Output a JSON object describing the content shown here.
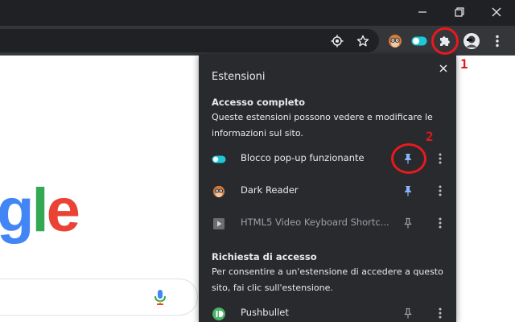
{
  "window_controls": {
    "minimize_icon": "minimize-icon",
    "maximize_icon": "restore-icon",
    "close_icon": "close-icon"
  },
  "toolbar": {
    "icons": [
      "location-target-icon",
      "bookmark-star-icon",
      "dark-reader-extension-icon",
      "toggle-extension-icon",
      "puzzle-extensions-icon",
      "profile-avatar",
      "menu-kebab-icon"
    ]
  },
  "page": {
    "logo_text_g": "g",
    "logo_text_l": "l",
    "logo_text_e": "e"
  },
  "panel": {
    "title": "Estensioni",
    "full_access": {
      "title": "Accesso completo",
      "description": "Queste estensioni possono vedere e modificare le informazioni sul sito.",
      "items": [
        {
          "name": "Blocco pop-up funzionante",
          "icon": "toggle-icon",
          "pinned": true
        },
        {
          "name": "Dark Reader",
          "icon": "dark-reader-icon",
          "pinned": true
        },
        {
          "name": "HTML5 Video Keyboard Shortc...",
          "icon": "video-play-icon",
          "pinned": false
        }
      ]
    },
    "access_request": {
      "title": "Richiesta di accesso",
      "description": "Per consentire a un'estensione di accedere a questo sito, fai clic sull'estensione.",
      "items": [
        {
          "name": "Pushbullet",
          "icon": "pushbullet-icon",
          "pinned": false
        }
      ]
    }
  },
  "annotations": {
    "label_1": "1",
    "label_2": "2",
    "color": "#e8191f"
  },
  "colors": {
    "titlebar": "#202124",
    "toolbar": "#35363a",
    "panel": "#292a2d",
    "pin_active": "#8ab4f8",
    "toggle_accent": "#1ec8d8"
  }
}
